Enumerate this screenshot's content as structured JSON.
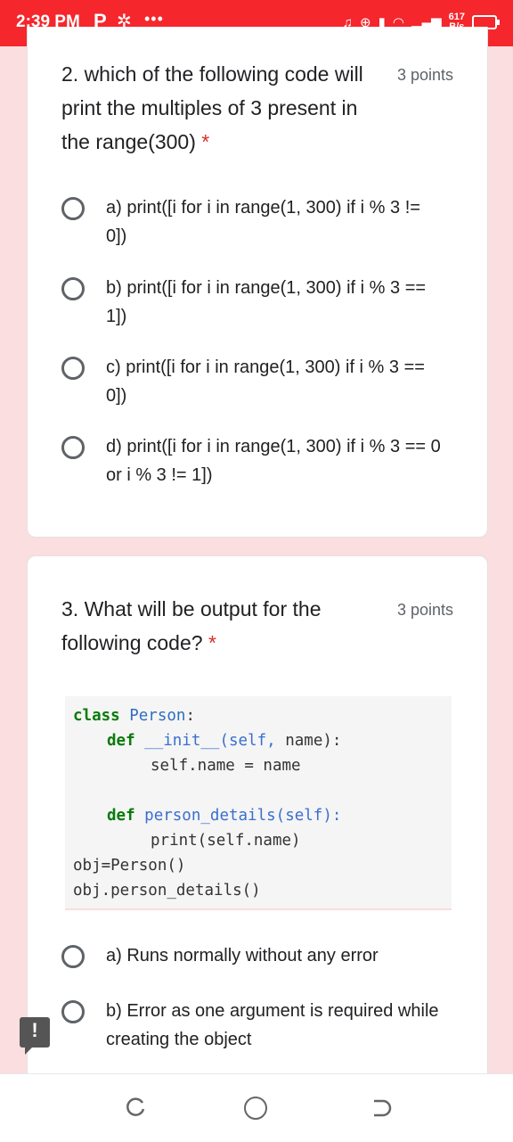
{
  "status_bar": {
    "time": "2:39 PM",
    "net_speed_value": "617",
    "net_speed_unit": "B/s"
  },
  "question2": {
    "title": "2. which of the following code will print the multiples of 3 present in the range(300)",
    "required_mark": "*",
    "points": "3 points",
    "options": [
      "a) print([i for i in range(1, 300) if i % 3 != 0])",
      "b) print([i for i in range(1, 300) if i % 3 == 1])",
      "c) print([i for i in range(1, 300) if i % 3 == 0])",
      "d) print([i for i in range(1, 300) if i % 3 == 0 or i % 3 != 1])"
    ]
  },
  "question3": {
    "title": "3. What will be output for the following code?",
    "required_mark": "*",
    "points": "3 points",
    "code_lines": [
      {
        "kw": "class",
        "name": "Person",
        "rest": ":"
      },
      {
        "kw": "def",
        "name": "__init__(self,",
        "rest": " name):"
      },
      {
        "text": "self.name = name"
      },
      {
        "kw": "def",
        "name": "person_details(self):",
        "rest": ""
      },
      {
        "text": "print(self.name)"
      },
      {
        "text": "obj=Person()"
      },
      {
        "text": "obj.person_details()"
      }
    ],
    "options": [
      "a) Runs normally without any error",
      "b) Error as one argument is required while creating the object"
    ]
  },
  "icons": {
    "status": [
      "p-icon",
      "gear-icon",
      "more-dots-icon",
      "headset-icon",
      "add-circle-icon",
      "vibrate-icon",
      "wifi-icon",
      "signal-icon",
      "battery-icon"
    ],
    "feedback": "report-icon",
    "nav": [
      "recent-apps-icon",
      "home-icon",
      "back-icon"
    ]
  },
  "colors": {
    "status_bar": "#f5262c",
    "background": "#fbdee0",
    "required": "#d93025",
    "code_keyword": "#0a7a0a",
    "code_name": "#2f6fbf"
  }
}
